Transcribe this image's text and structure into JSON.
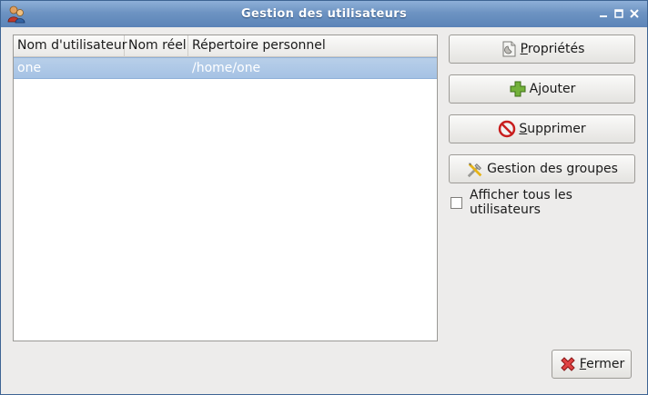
{
  "window": {
    "title": "Gestion des utilisateurs",
    "icons": [
      "users-app-icon",
      "minimize-icon",
      "maximize-icon",
      "close-icon"
    ]
  },
  "users_table": {
    "columns": [
      "Nom d'utilisateur",
      "Nom réel",
      "Répertoire personnel"
    ],
    "rows": [
      {
        "username": "one",
        "realname": "",
        "home": "/home/one",
        "selected": true
      }
    ]
  },
  "actions": {
    "properties": {
      "mnemonic": "P",
      "rest": "ropriétés",
      "icon": "properties-icon"
    },
    "add": {
      "before": "A",
      "mnemonic": "j",
      "rest": "outer",
      "icon": "add-icon"
    },
    "delete": {
      "mnemonic": "S",
      "rest": "upprimer",
      "icon": "delete-icon"
    },
    "groups": {
      "label": "Gestion des groupes",
      "icon": "groups-tools-icon"
    },
    "show_all": {
      "label": "Afficher tous les utilisateurs",
      "checked": false
    }
  },
  "footer": {
    "close": {
      "mnemonic": "F",
      "rest": "ermer",
      "icon": "close-red-icon"
    }
  },
  "colors": {
    "titlebar": "#6d93c2",
    "selection": "#a5c2e4",
    "window_bg": "#edeceb"
  }
}
